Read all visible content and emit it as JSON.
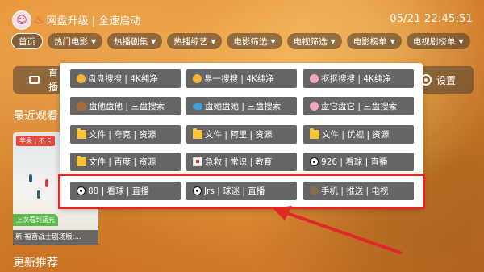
{
  "header": {
    "app_title": "网盘升级 | 全速启动",
    "clock": "05/21 22:45:51"
  },
  "tabs": [
    {
      "label": "首页",
      "active": true
    },
    {
      "label": "热门电影",
      "filter": true
    },
    {
      "label": "热播剧集",
      "filter": true
    },
    {
      "label": "热播综艺",
      "filter": true
    },
    {
      "label": "电影筛选",
      "filter": true
    },
    {
      "label": "电视筛选",
      "filter": true
    },
    {
      "label": "电影榜单",
      "filter": true
    },
    {
      "label": "电视剧榜单",
      "filter": true
    }
  ],
  "background": {
    "left_tile_label": "直播",
    "settings_label": "设置",
    "recent_title": "最近观看",
    "recommend_title": "更新推荐",
    "poster": {
      "source_tag": "苹果 | 不卡",
      "progress_tag": "上次看到蓝光",
      "title": "新·福音战士剧场版:..."
    }
  },
  "popup": {
    "rows": [
      [
        {
          "label": "盘盘搜搜 | 4K纯净",
          "icon": "face-icon"
        },
        {
          "label": "易一搜搜 | 4K纯净",
          "icon": "face-icon"
        },
        {
          "label": "抠抠搜搜 | 4K纯净",
          "icon": "pig-icon"
        }
      ],
      [
        {
          "label": "盘他盘他 | 三盘搜索",
          "icon": "snail-icon"
        },
        {
          "label": "盘她盘她 | 三盘搜索",
          "icon": "fish-icon"
        },
        {
          "label": "盘它盘它 | 三盘搜索",
          "icon": "pig-icon"
        }
      ],
      [
        {
          "label": "文件 | 夸克 | 资源",
          "icon": "folder-icon"
        },
        {
          "label": "文件 | 阿里 | 资源",
          "icon": "folder-icon"
        },
        {
          "label": "文件 | 优视 | 资源",
          "icon": "folder-icon"
        }
      ],
      [
        {
          "label": "文件 | 百度 | 资源",
          "icon": "folder-icon"
        },
        {
          "label": "急救 | 常识 | 教育",
          "icon": "ambulance-icon"
        },
        {
          "label": "926 | 看球 | 直播",
          "icon": "soccer-ball-icon"
        }
      ],
      [
        {
          "label": "88 | 看球 | 直播",
          "icon": "soccer-ball-icon"
        },
        {
          "label": "Jrs | 球迷 | 直播",
          "icon": "soccer-ball-icon"
        },
        {
          "label": "手机 | 推送 | 电视",
          "icon": "phone-icon"
        }
      ]
    ]
  },
  "colors": {
    "highlight": "#e02828",
    "button_bg": "#666666",
    "accent": "#ff3b2f"
  }
}
